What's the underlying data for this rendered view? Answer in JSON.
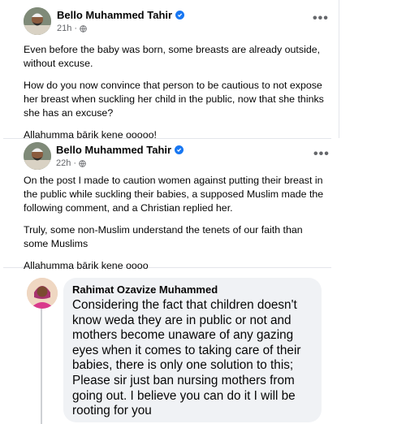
{
  "post1": {
    "author": "Bello Muhammed Tahir",
    "time": "21h",
    "more_label": "•••",
    "paragraphs": [
      "Even before the baby was born, some breasts are already outside, without excuse.",
      "How do you now convince that person to be cautious to not expose her breast when suckling her child in the public, now that she thinks she has an excuse?",
      "Allahumma bārik kene ooooo!"
    ]
  },
  "post2": {
    "author": "Bello Muhammed Tahir",
    "time": "22h",
    "more_label": "•••",
    "paragraphs": [
      "On the post I made to caution women against putting their breast in the public while suckling their babies, a supposed Muslim made the following comment, and a Christian replied her.",
      "Truly, some non-Muslim understand the tenets of our faith than some Muslims",
      "Allahumma bārik kene oooo"
    ]
  },
  "comment": {
    "author": "Rahimat Ozavize Muhammed",
    "text": "Considering the fact that children doesn't know weda they are in public or not and mothers become unaware of any gazing eyes when it comes to taking care of their babies, there is only one solution to this; Please sir just ban nursing mothers from going out. I believe you can do it I will be rooting for you"
  },
  "icons": {
    "verified": "verified-badge-icon",
    "globe": "globe-icon",
    "more": "more-options-icon"
  },
  "colors": {
    "verified": "#1877f2",
    "secondary_text": "#65676b",
    "bubble": "#f0f2f5"
  }
}
